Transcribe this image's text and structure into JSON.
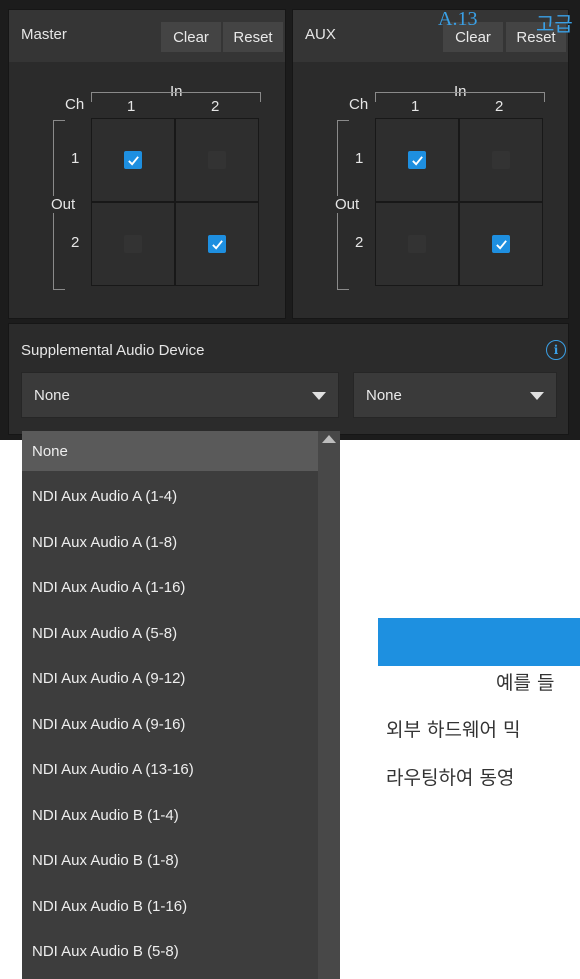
{
  "master_panel": {
    "title": "Master",
    "clear_label": "Clear",
    "reset_label": "Reset",
    "in_label": "In",
    "ch_label": "Ch",
    "out_label": "Out",
    "in_cols": [
      "1",
      "2"
    ],
    "out_rows": [
      "1",
      "2"
    ],
    "matrix": [
      [
        true,
        false
      ],
      [
        false,
        true
      ]
    ]
  },
  "aux_panel": {
    "title": "AUX",
    "clear_label": "Clear",
    "reset_label": "Reset",
    "in_label": "In",
    "ch_label": "Ch",
    "out_label": "Out",
    "in_cols": [
      "1",
      "2"
    ],
    "out_rows": [
      "1",
      "2"
    ],
    "matrix": [
      [
        true,
        false
      ],
      [
        false,
        true
      ]
    ]
  },
  "overlay": {
    "page_number": "A.13",
    "heading_fragment": "고급"
  },
  "supplemental": {
    "label": "Supplemental Audio Device",
    "info_icon": "info-icon",
    "select_left_value": "None",
    "select_right_value": "None"
  },
  "dropdown": {
    "items": [
      "None",
      "NDI Aux Audio A (1-4)",
      "NDI Aux Audio A (1-8)",
      "NDI Aux Audio A (1-16)",
      "NDI Aux Audio A (5-8)",
      "NDI Aux Audio A (9-12)",
      "NDI Aux Audio A (9-16)",
      "NDI Aux Audio A (13-16)",
      "NDI Aux Audio B (1-4)",
      "NDI Aux Audio B (1-8)",
      "NDI Aux Audio B (1-16)",
      "NDI Aux Audio B (5-8)"
    ],
    "selected_index": 0
  },
  "page_text": {
    "line1": "예를 들",
    "line2": "외부 하드웨어 믹",
    "line3": "라우팅하여 동영"
  },
  "colors": {
    "accent": "#1e8fe0",
    "panel_bg": "#2b2b2b",
    "header_bg": "#353535",
    "dropdown_bg": "#3d3d3d",
    "selected_item_bg": "#5a5a5a"
  }
}
